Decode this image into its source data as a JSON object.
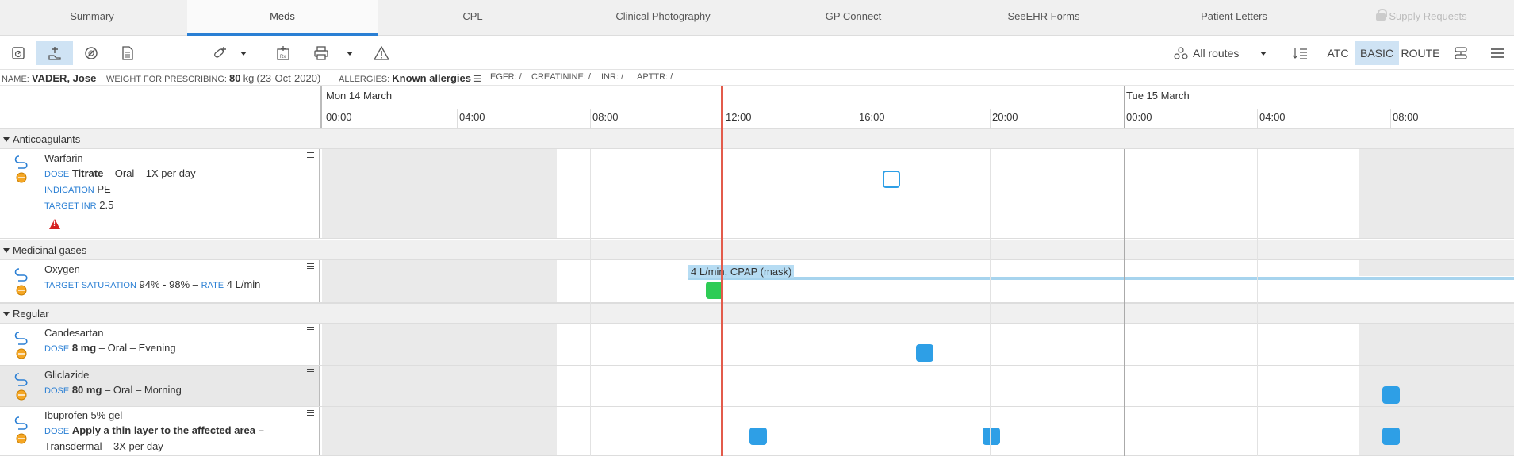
{
  "tabs": [
    "Summary",
    "Meds",
    "CPL",
    "Clinical Photography",
    "GP Connect",
    "SeeEHR Forms",
    "Patient Letters",
    "Supply Requests"
  ],
  "toolbar": {
    "routes": "All routes",
    "atc": "ATC",
    "basic": "BASIC",
    "route": "ROUTE"
  },
  "banner": {
    "name_label": "NAME:",
    "name": "VADER, Jose",
    "weight_label": "WEIGHT FOR PRESCRIBING:",
    "weight": "80",
    "weight_unit": "kg",
    "weight_date": "(23-Oct-2020)",
    "allergies_label": "ALLERGIES:",
    "allergies": "Known allergies",
    "egfr": "EGFR: /",
    "creatinine": "CREATININE: /",
    "inr": "INR: /",
    "apttr": "APTTR: /"
  },
  "timeline": {
    "day1": "Mon 14 March",
    "day2": "Tue 15 March",
    "hours": [
      "00:00",
      "04:00",
      "08:00",
      "12:00",
      "16:00",
      "20:00",
      "00:00",
      "04:00",
      "08:00"
    ]
  },
  "groups": {
    "anticoag": "Anticoagulants",
    "gases": "Medicinal gases",
    "regular": "Regular"
  },
  "meds": {
    "warfarin": {
      "name": "Warfarin",
      "dose_label": "DOSE",
      "dose": "Titrate",
      "dose_rest": " – Oral – 1X per day",
      "ind_label": "INDICATION",
      "ind": "PE",
      "inr_label": "TARGET INR",
      "inr": "2.5"
    },
    "oxygen": {
      "name": "Oxygen",
      "sat_label": "TARGET SATURATION",
      "sat": "94% - 98%",
      "sep": " – ",
      "rate_label": "RATE",
      "rate": "4 L/min",
      "band_label": "4 L/min, CPAP (mask)"
    },
    "candesartan": {
      "name": "Candesartan",
      "dose_label": "DOSE",
      "dose": "8 mg",
      "dose_rest": " – Oral – Evening"
    },
    "gliclazide": {
      "name": "Gliclazide",
      "dose_label": "DOSE",
      "dose": "80 mg",
      "dose_rest": " – Oral – Morning"
    },
    "ibuprofen": {
      "name": "Ibuprofen 5% gel",
      "dose_label": "DOSE",
      "dose": "Apply a thin layer to the affected area –",
      "dose_rest": "Transdermal – 3X per day"
    }
  },
  "colors": {
    "accent": "#2a7fd4",
    "marker": "#2e9fe6",
    "now": "#e35b4b",
    "given": "#2ecc55"
  }
}
